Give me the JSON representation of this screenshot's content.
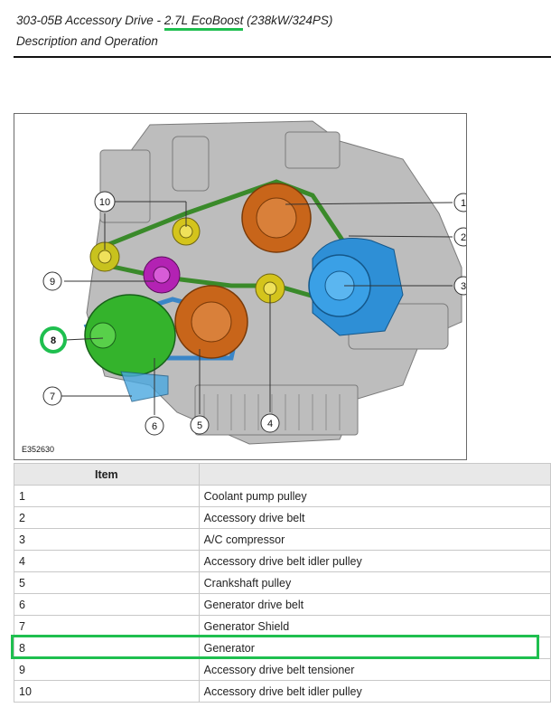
{
  "header": {
    "title_prefix": "303-05B Accessory Drive - ",
    "title_engine": "2.7L EcoBoost",
    "title_suffix": " (238kW/324PS)",
    "subtitle": "Description and Operation"
  },
  "figure": {
    "code": "E352630",
    "callouts": [
      "1",
      "2",
      "3",
      "4",
      "5",
      "6",
      "7",
      "8",
      "9",
      "10"
    ],
    "highlight_color": "#1fbf4f"
  },
  "table": {
    "header_item": "Item",
    "header_desc": "",
    "rows": [
      {
        "item": "1",
        "desc": "Coolant pump pulley"
      },
      {
        "item": "2",
        "desc": "Accessory drive belt"
      },
      {
        "item": "3",
        "desc": "A/C compressor"
      },
      {
        "item": "4",
        "desc": "Accessory drive belt idler pulley"
      },
      {
        "item": "5",
        "desc": "Crankshaft pulley"
      },
      {
        "item": "6",
        "desc": "Generator drive belt"
      },
      {
        "item": "7",
        "desc": "Generator Shield"
      },
      {
        "item": "8",
        "desc": "Generator"
      },
      {
        "item": "9",
        "desc": "Accessory drive belt tensioner"
      },
      {
        "item": "10",
        "desc": "Accessory drive belt idler pulley"
      }
    ]
  }
}
